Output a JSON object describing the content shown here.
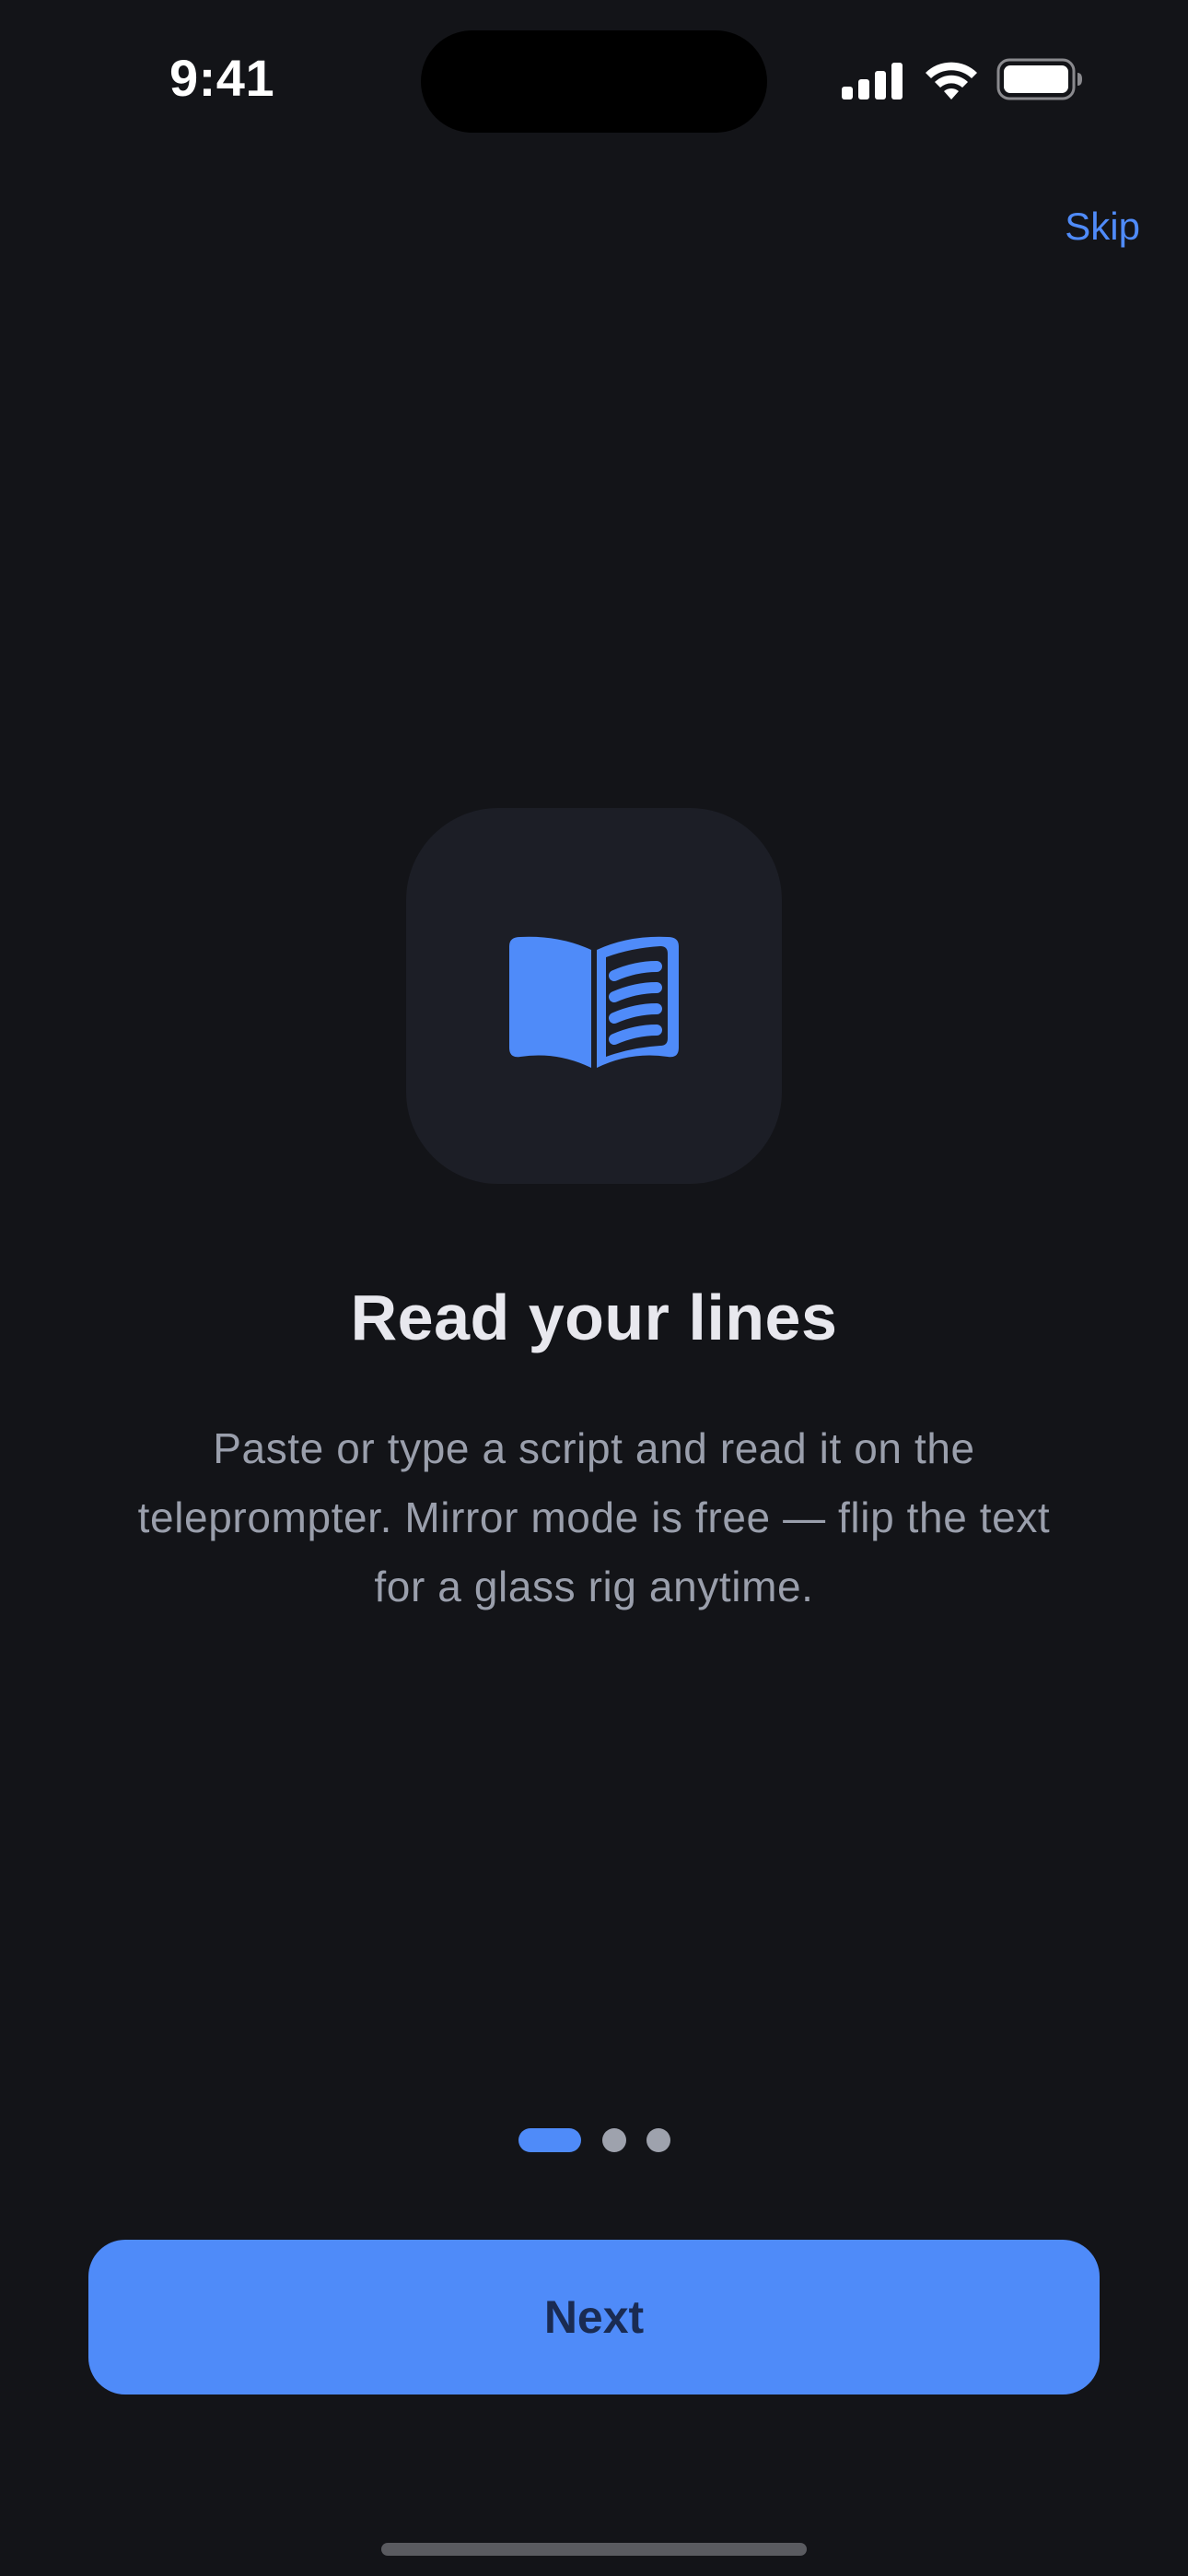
{
  "status_bar": {
    "time": "9:41",
    "icons": [
      "cellular-signal-icon",
      "wifi-icon",
      "battery-icon"
    ]
  },
  "header": {
    "skip_label": "Skip"
  },
  "hero": {
    "icon": "open-book-icon",
    "title": "Read your lines",
    "description": "Paste or type a script and read it on the teleprompter. Mirror mode is free — flip the text for a glass rig anytime."
  },
  "pagination": {
    "total_pages": 3,
    "current_page": 1
  },
  "footer": {
    "next_label": "Next"
  },
  "colors": {
    "background": "#131418",
    "accent": "#4f8bf9",
    "tile": "#1c1e26",
    "button_text": "#1a2b52",
    "muted_text": "#9a9fac"
  }
}
